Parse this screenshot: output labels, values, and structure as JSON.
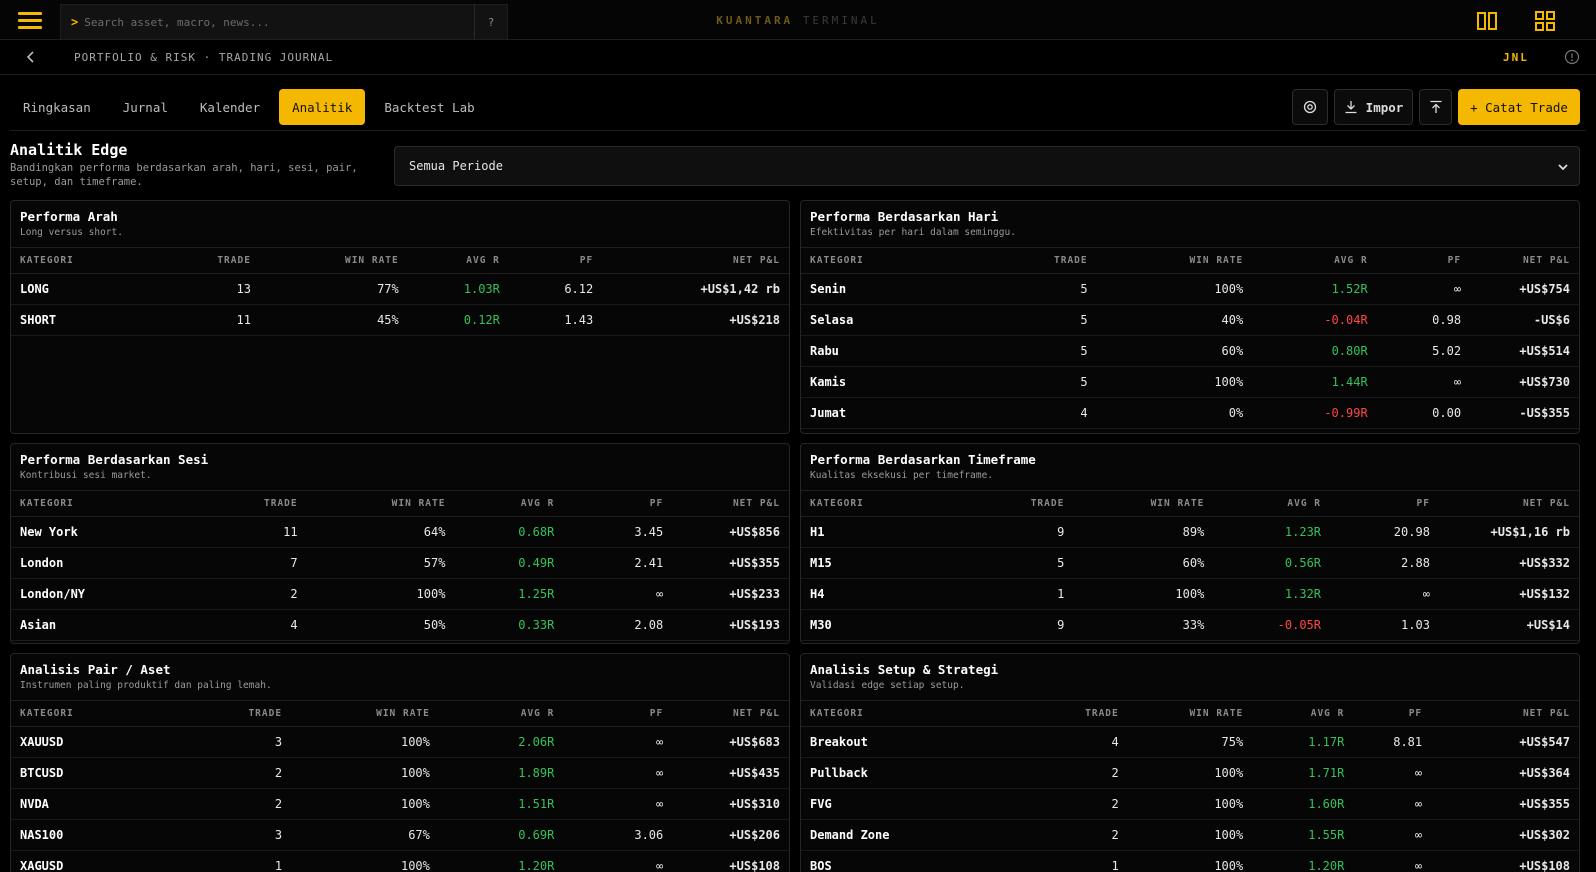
{
  "colors": {
    "accent": "#f5b800",
    "positive": "#3fcf64",
    "negative": "#ff4646"
  },
  "topbar": {
    "search_placeholder": "Search asset, macro, news...",
    "search_prompt": ">",
    "help_label": "?",
    "brand_primary": "KUANTARA",
    "brand_secondary": "TERMINAL",
    "icons": [
      "menu-icon",
      "split-view-icon",
      "grid-view-icon"
    ]
  },
  "subbar": {
    "breadcrumb": "PORTFOLIO & RISK · TRADING JOURNAL",
    "code": "JNL"
  },
  "tabs": [
    {
      "label": "Ringkasan",
      "active": false
    },
    {
      "label": "Jurnal",
      "active": false
    },
    {
      "label": "Kalender",
      "active": false
    },
    {
      "label": "Analitik",
      "active": true
    },
    {
      "label": "Backtest Lab",
      "active": false
    }
  ],
  "actions": {
    "import_label": "Impor",
    "add_trade_label": "+ Catat Trade"
  },
  "section": {
    "title": "Analitik Edge",
    "subtitle": "Bandingkan performa berdasarkan arah, hari, sesi, pair, setup, dan timeframe.",
    "period_selected": "Semua Periode"
  },
  "columns": [
    "KATEGORI",
    "TRADE",
    "WIN RATE",
    "AVG R",
    "PF",
    "NET P&L"
  ],
  "panels": [
    {
      "title": "Performa Arah",
      "subtitle": "Long versus short.",
      "rows": [
        [
          "LONG",
          "13",
          "77%",
          "1.03R",
          "6.12",
          "+US$1,42 rb"
        ],
        [
          "SHORT",
          "11",
          "45%",
          "0.12R",
          "1.43",
          "+US$218"
        ]
      ]
    },
    {
      "title": "Performa Berdasarkan Hari",
      "subtitle": "Efektivitas per hari dalam seminggu.",
      "rows": [
        [
          "Senin",
          "5",
          "100%",
          "1.52R",
          "∞",
          "+US$754"
        ],
        [
          "Selasa",
          "5",
          "40%",
          "-0.04R",
          "0.98",
          "-US$6"
        ],
        [
          "Rabu",
          "5",
          "60%",
          "0.80R",
          "5.02",
          "+US$514"
        ],
        [
          "Kamis",
          "5",
          "100%",
          "1.44R",
          "∞",
          "+US$730"
        ],
        [
          "Jumat",
          "4",
          "0%",
          "-0.99R",
          "0.00",
          "-US$355"
        ]
      ]
    },
    {
      "title": "Performa Berdasarkan Sesi",
      "subtitle": "Kontribusi sesi market.",
      "rows": [
        [
          "New York",
          "11",
          "64%",
          "0.68R",
          "3.45",
          "+US$856"
        ],
        [
          "London",
          "7",
          "57%",
          "0.49R",
          "2.41",
          "+US$355"
        ],
        [
          "London/NY",
          "2",
          "100%",
          "1.25R",
          "∞",
          "+US$233"
        ],
        [
          "Asian",
          "4",
          "50%",
          "0.33R",
          "2.08",
          "+US$193"
        ]
      ]
    },
    {
      "title": "Performa Berdasarkan Timeframe",
      "subtitle": "Kualitas eksekusi per timeframe.",
      "rows": [
        [
          "H1",
          "9",
          "89%",
          "1.23R",
          "20.98",
          "+US$1,16 rb"
        ],
        [
          "M15",
          "5",
          "60%",
          "0.56R",
          "2.88",
          "+US$332"
        ],
        [
          "H4",
          "1",
          "100%",
          "1.32R",
          "∞",
          "+US$132"
        ],
        [
          "M30",
          "9",
          "33%",
          "-0.05R",
          "1.03",
          "+US$14"
        ]
      ]
    },
    {
      "title": "Analisis Pair / Aset",
      "subtitle": "Instrumen paling produktif dan paling lemah.",
      "rows": [
        [
          "XAUUSD",
          "3",
          "100%",
          "2.06R",
          "∞",
          "+US$683"
        ],
        [
          "BTCUSD",
          "2",
          "100%",
          "1.89R",
          "∞",
          "+US$435"
        ],
        [
          "NVDA",
          "2",
          "100%",
          "1.51R",
          "∞",
          "+US$310"
        ],
        [
          "NAS100",
          "3",
          "67%",
          "0.69R",
          "3.06",
          "+US$206"
        ],
        [
          "XAGUSD",
          "1",
          "100%",
          "1.20R",
          "∞",
          "+US$108"
        ]
      ]
    },
    {
      "title": "Analisis Setup & Strategi",
      "subtitle": "Validasi edge setiap setup.",
      "rows": [
        [
          "Breakout",
          "4",
          "75%",
          "1.17R",
          "8.81",
          "+US$547"
        ],
        [
          "Pullback",
          "2",
          "100%",
          "1.71R",
          "∞",
          "+US$364"
        ],
        [
          "FVG",
          "2",
          "100%",
          "1.60R",
          "∞",
          "+US$355"
        ],
        [
          "Demand Zone",
          "2",
          "100%",
          "1.55R",
          "∞",
          "+US$302"
        ],
        [
          "BOS",
          "1",
          "100%",
          "1.20R",
          "∞",
          "+US$108"
        ]
      ]
    }
  ]
}
